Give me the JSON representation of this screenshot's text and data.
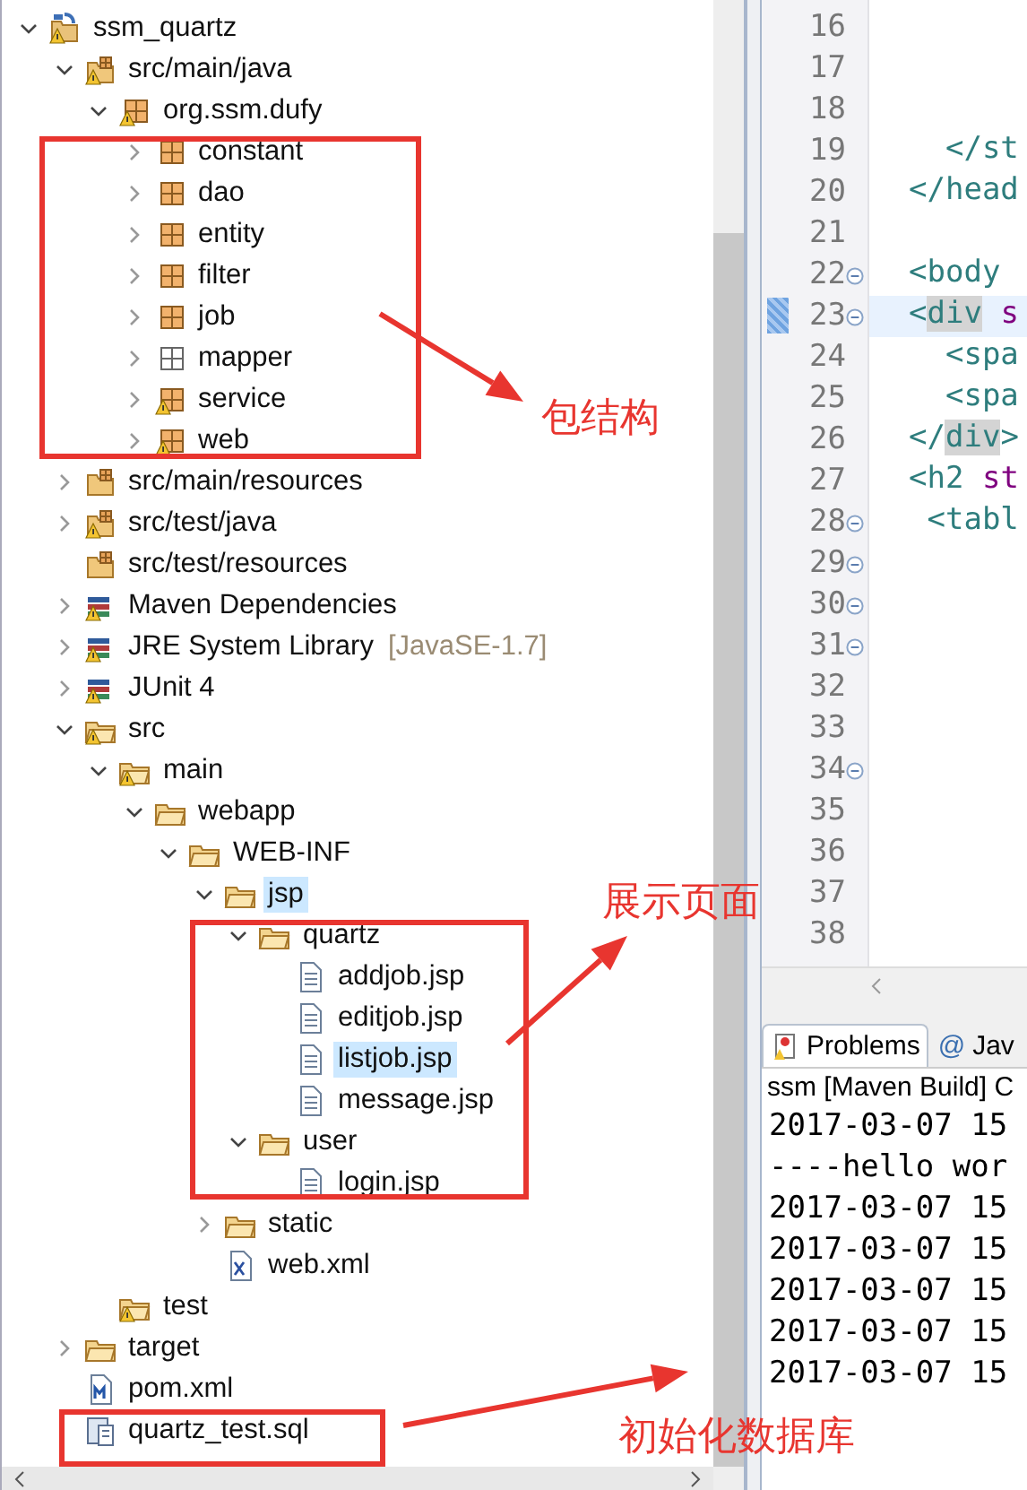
{
  "project_explorer": {
    "tree": [
      {
        "label": "ssm_quartz",
        "kind": "project",
        "warning": true,
        "expanded": true,
        "selected": false,
        "children": [
          {
            "label": "src/main/java",
            "kind": "source-folder",
            "warning": true,
            "expanded": true,
            "selected": false,
            "children": [
              {
                "label": "org.ssm.dufy",
                "kind": "package",
                "warning": true,
                "expanded": true,
                "selected": false,
                "children": [
                  {
                    "label": "constant",
                    "kind": "package",
                    "warning": false,
                    "expanded": false,
                    "selected": false
                  },
                  {
                    "label": "dao",
                    "kind": "package",
                    "warning": false,
                    "expanded": false,
                    "selected": false
                  },
                  {
                    "label": "entity",
                    "kind": "package",
                    "warning": false,
                    "expanded": false,
                    "selected": false
                  },
                  {
                    "label": "filter",
                    "kind": "package",
                    "warning": false,
                    "expanded": false,
                    "selected": false
                  },
                  {
                    "label": "job",
                    "kind": "package",
                    "warning": false,
                    "expanded": false,
                    "selected": false
                  },
                  {
                    "label": "mapper",
                    "kind": "empty-package",
                    "warning": false,
                    "expanded": false,
                    "selected": false
                  },
                  {
                    "label": "service",
                    "kind": "package",
                    "warning": true,
                    "expanded": false,
                    "selected": false
                  },
                  {
                    "label": "web",
                    "kind": "package",
                    "warning": true,
                    "expanded": false,
                    "selected": false
                  }
                ]
              }
            ]
          },
          {
            "label": "src/main/resources",
            "kind": "source-folder",
            "warning": false,
            "expanded": false,
            "selected": false
          },
          {
            "label": "src/test/java",
            "kind": "source-folder",
            "warning": true,
            "expanded": false,
            "selected": false
          },
          {
            "label": "src/test/resources",
            "kind": "source-folder",
            "warning": false,
            "selected": false
          },
          {
            "label": "Maven Dependencies",
            "kind": "library",
            "warning": true,
            "expanded": false,
            "selected": false
          },
          {
            "label": "JRE System Library",
            "decoration": "[JavaSE-1.7]",
            "kind": "library",
            "warning": true,
            "expanded": false,
            "selected": false
          },
          {
            "label": "JUnit 4",
            "kind": "library",
            "warning": true,
            "expanded": false,
            "selected": false
          },
          {
            "label": "src",
            "kind": "folder",
            "warning": true,
            "expanded": true,
            "selected": false,
            "children": [
              {
                "label": "main",
                "kind": "folder",
                "warning": true,
                "expanded": true,
                "selected": false,
                "children": [
                  {
                    "label": "webapp",
                    "kind": "folder",
                    "warning": false,
                    "expanded": true,
                    "selected": false,
                    "children": [
                      {
                        "label": "WEB-INF",
                        "kind": "folder",
                        "warning": false,
                        "expanded": true,
                        "selected": false,
                        "children": [
                          {
                            "label": "jsp",
                            "kind": "folder",
                            "warning": false,
                            "expanded": true,
                            "selected": true,
                            "children": [
                              {
                                "label": "quartz",
                                "kind": "folder",
                                "warning": false,
                                "expanded": true,
                                "selected": false,
                                "children": [
                                  {
                                    "label": "addjob.jsp",
                                    "kind": "file",
                                    "warning": false,
                                    "selected": false
                                  },
                                  {
                                    "label": "editjob.jsp",
                                    "kind": "file",
                                    "warning": false,
                                    "selected": false
                                  },
                                  {
                                    "label": "listjob.jsp",
                                    "kind": "file",
                                    "warning": false,
                                    "selected": true
                                  },
                                  {
                                    "label": "message.jsp",
                                    "kind": "file",
                                    "warning": false,
                                    "selected": false
                                  }
                                ]
                              },
                              {
                                "label": "user",
                                "kind": "folder",
                                "warning": false,
                                "expanded": true,
                                "selected": false,
                                "children": [
                                  {
                                    "label": "login.jsp",
                                    "kind": "file",
                                    "warning": false,
                                    "selected": false
                                  }
                                ]
                              }
                            ]
                          },
                          {
                            "label": "static",
                            "kind": "folder",
                            "warning": false,
                            "expanded": false,
                            "selected": false
                          },
                          {
                            "label": "web.xml",
                            "kind": "xml",
                            "warning": false,
                            "selected": false
                          }
                        ]
                      }
                    ]
                  }
                ]
              },
              {
                "label": "test",
                "kind": "folder",
                "warning": true,
                "selected": false
              }
            ]
          },
          {
            "label": "target",
            "kind": "folder",
            "warning": false,
            "expanded": false,
            "selected": false
          },
          {
            "label": "pom.xml",
            "kind": "maven",
            "warning": false,
            "selected": false
          },
          {
            "label": "quartz_test.sql",
            "kind": "sql",
            "warning": false,
            "selected": false
          }
        ]
      }
    ]
  },
  "editor": {
    "lines": [
      {
        "number": "16",
        "fold": false,
        "current": false
      },
      {
        "number": "17",
        "fold": false,
        "current": false
      },
      {
        "number": "18",
        "fold": false,
        "current": false
      },
      {
        "number": "19",
        "fold": false,
        "current": false,
        "code": [
          {
            "text": "  </st",
            "kind": "tag",
            "highlight": false
          }
        ]
      },
      {
        "number": "20",
        "fold": false,
        "current": false,
        "code": [
          {
            "text": "</head",
            "kind": "tag",
            "highlight": false
          }
        ]
      },
      {
        "number": "21",
        "fold": false,
        "current": false
      },
      {
        "number": "22",
        "fold": true,
        "current": false,
        "code": [
          {
            "text": "<body",
            "kind": "tag",
            "highlight": false
          }
        ]
      },
      {
        "number": "23",
        "fold": true,
        "current": true,
        "code": [
          {
            "text": "<",
            "kind": "tag",
            "highlight": false
          },
          {
            "text": "div",
            "kind": "tag",
            "highlight": true
          },
          {
            "text": " s",
            "kind": "attr",
            "highlight": false
          }
        ]
      },
      {
        "number": "24",
        "fold": false,
        "current": false,
        "code": [
          {
            "text": "  <spa",
            "kind": "tag",
            "highlight": false
          }
        ]
      },
      {
        "number": "25",
        "fold": false,
        "current": false,
        "code": [
          {
            "text": "  <spa",
            "kind": "tag",
            "highlight": false
          }
        ]
      },
      {
        "number": "26",
        "fold": false,
        "current": false,
        "code": [
          {
            "text": "</",
            "kind": "tag",
            "highlight": false
          },
          {
            "text": "div",
            "kind": "tag",
            "highlight": true
          },
          {
            "text": ">",
            "kind": "tag",
            "highlight": false
          }
        ]
      },
      {
        "number": "27",
        "fold": false,
        "current": false,
        "code": [
          {
            "text": "<h2",
            "kind": "tag",
            "highlight": false
          },
          {
            "text": " st",
            "kind": "attr",
            "highlight": false
          }
        ]
      },
      {
        "number": "28",
        "fold": true,
        "current": false,
        "code": [
          {
            "text": " <tabl",
            "kind": "tag",
            "highlight": false
          }
        ]
      },
      {
        "number": "29",
        "fold": true,
        "current": false
      },
      {
        "number": "30",
        "fold": true,
        "current": false
      },
      {
        "number": "31",
        "fold": true,
        "current": false
      },
      {
        "number": "32",
        "fold": false,
        "current": false
      },
      {
        "number": "33",
        "fold": false,
        "current": false
      },
      {
        "number": "34",
        "fold": true,
        "current": false
      },
      {
        "number": "35",
        "fold": false,
        "current": false
      },
      {
        "number": "36",
        "fold": false,
        "current": false
      },
      {
        "number": "37",
        "fold": false,
        "current": false
      },
      {
        "number": "38",
        "fold": false,
        "current": false
      }
    ]
  },
  "bottom_panel": {
    "tabs": [
      {
        "label": "Problems",
        "kind": "problems",
        "selected": true
      },
      {
        "label": "Jav",
        "kind": "javadoc",
        "glyph": "@",
        "selected": false
      }
    ],
    "console_title": "ssm [Maven Build] C",
    "console_lines": [
      "2017-03-07 15",
      "----hello wor",
      "2017-03-07 15",
      "2017-03-07 15",
      "2017-03-07 15",
      "2017-03-07 15",
      "2017-03-07 15"
    ]
  },
  "annotations": [
    {
      "label": "包结构"
    },
    {
      "label": "展示页面"
    },
    {
      "label": "初始化数据库"
    }
  ]
}
